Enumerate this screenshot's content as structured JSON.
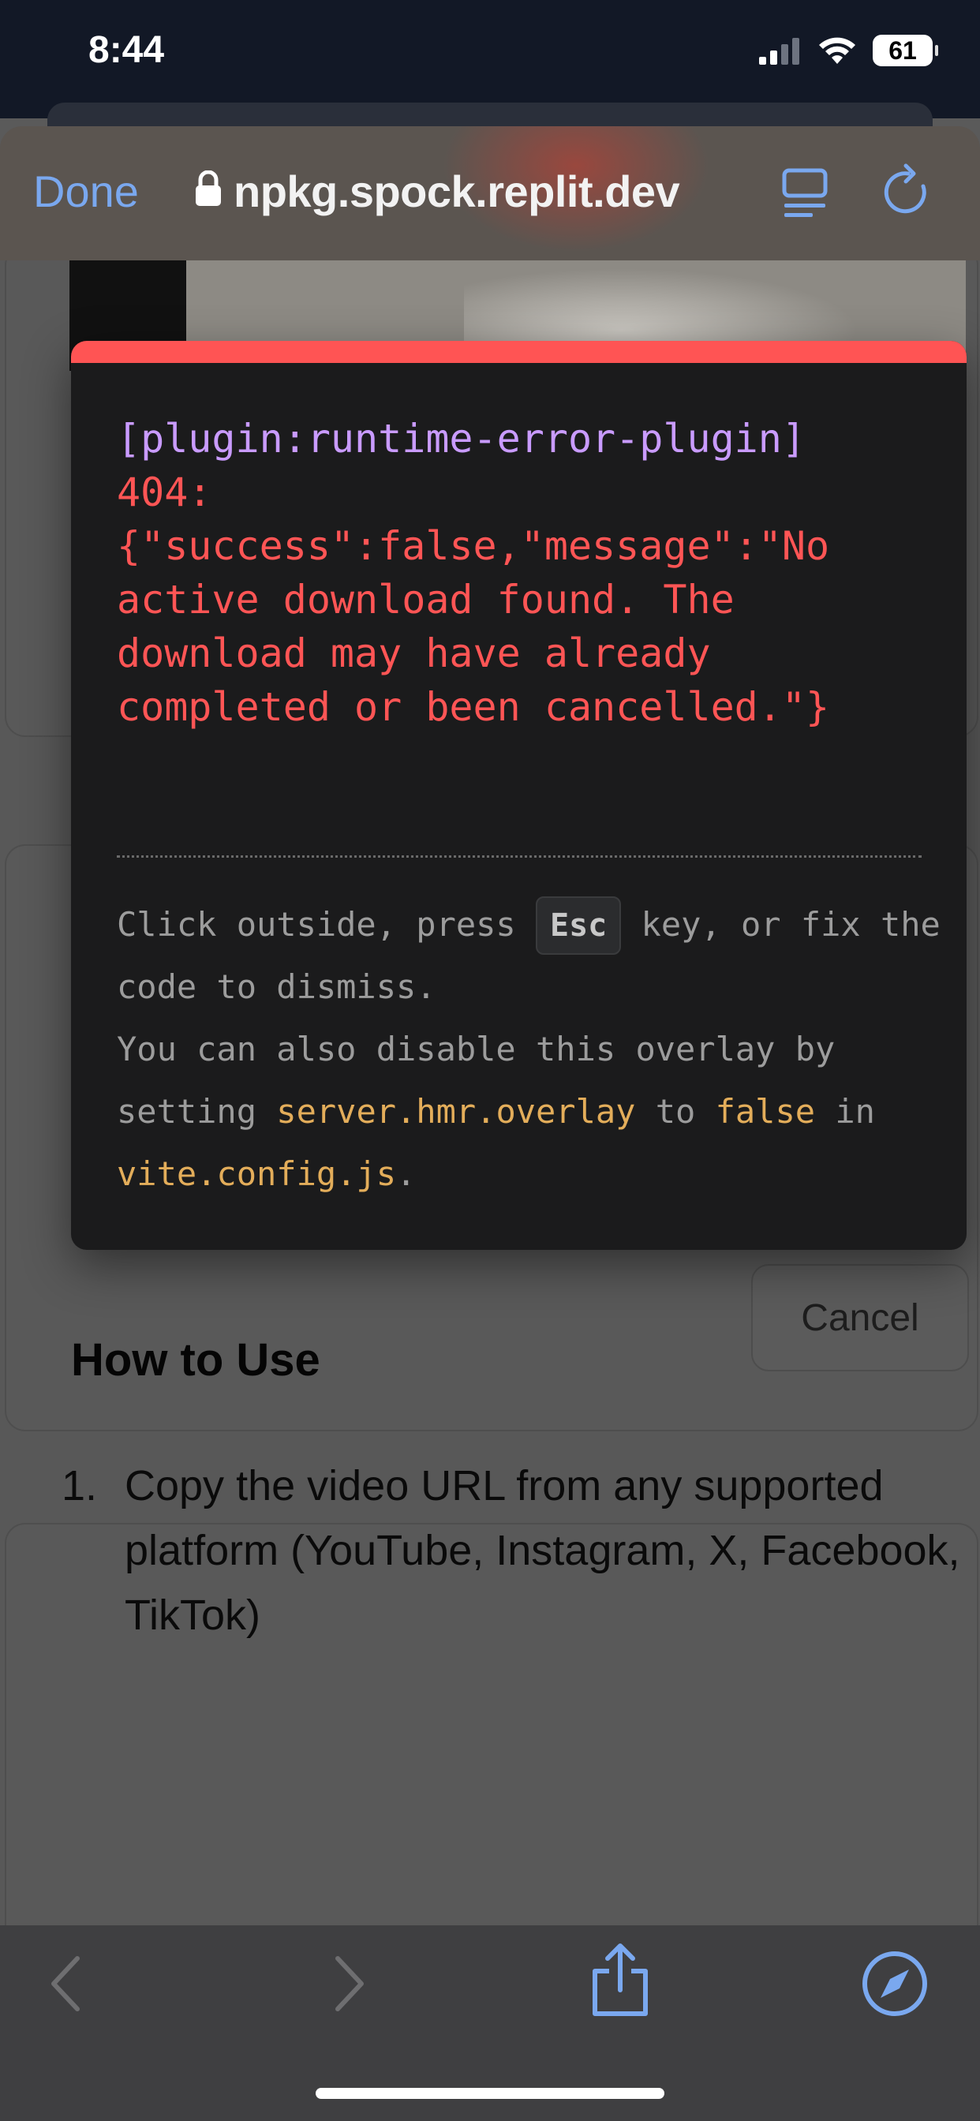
{
  "status_bar": {
    "time": "8:44",
    "battery": "61"
  },
  "browser": {
    "done_label": "Done",
    "url": "npkg.spock.replit.dev",
    "accent_color": "#7aa8ef"
  },
  "error_overlay": {
    "plugin": "[plugin:runtime-error-plugin]",
    "message": "404:\n{\"success\":false,\"message\":\"No\nactive download found. The\ndownload may have already\ncompleted or been cancelled.\"}",
    "tip": {
      "part1": "Click outside, press ",
      "key": "Esc",
      "part2": " key, or fix the code to dismiss.",
      "line2": "You can also disable this overlay by setting ",
      "setting_name": "server.hmr.overlay",
      "to": " to ",
      "false_value": "false",
      "in": " in ",
      "config_file": "vite.config.js",
      "end": "."
    },
    "accent_color": "#ff5454"
  },
  "page": {
    "cancel_label": "Cancel",
    "how_to_use": {
      "title": "How to Use",
      "steps": [
        {
          "number": "1.",
          "text": "Copy the video URL from any supported platform (YouTube, Instagram, X, Facebook, TikTok)"
        }
      ]
    }
  },
  "toolbar": {
    "icons": [
      "back-icon",
      "forward-icon",
      "share-icon",
      "compass-icon"
    ]
  }
}
